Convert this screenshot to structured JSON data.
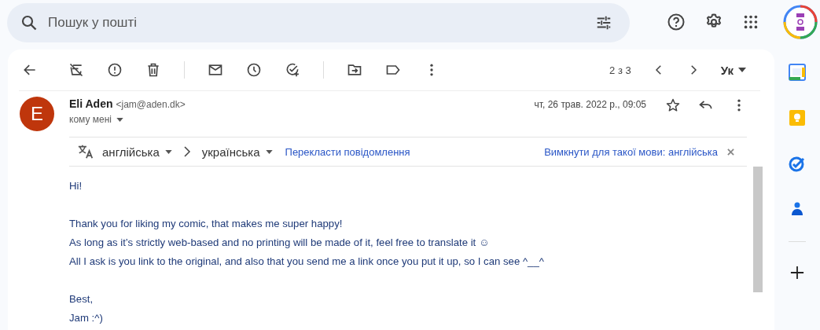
{
  "search": {
    "placeholder": "Пошук у пошті"
  },
  "toolbar": {
    "pager": "2 з 3",
    "input_tool": "Ук"
  },
  "message": {
    "avatar_letter": "E",
    "sender_name": "Eli Aden",
    "sender_email": "<jam@aden.dk>",
    "recipient": "кому мені",
    "date": "чт, 26 трав. 2022 р., 09:05",
    "starred": false
  },
  "translate_bar": {
    "source_language": "англійська",
    "target_language": "українська",
    "translate_link": "Перекласти повідомлення",
    "disable_link": "Вимкнути для такої мови: англійська"
  },
  "body": [
    {
      "kind": "line",
      "text": "Hi!"
    },
    {
      "kind": "gap"
    },
    {
      "kind": "line",
      "text": "Thank you for liking my comic, that makes me super happy!"
    },
    {
      "kind": "line",
      "text": "As long as it’s strictly web-based and no printing will be made of it, feel free to translate it ☺"
    },
    {
      "kind": "line",
      "text": "All I ask is you link to the original, and also that you send me a link once you put it up, so I can see ^__^"
    },
    {
      "kind": "gap"
    },
    {
      "kind": "line",
      "text": "Best,"
    },
    {
      "kind": "line",
      "text": "Jam :^)"
    }
  ]
}
